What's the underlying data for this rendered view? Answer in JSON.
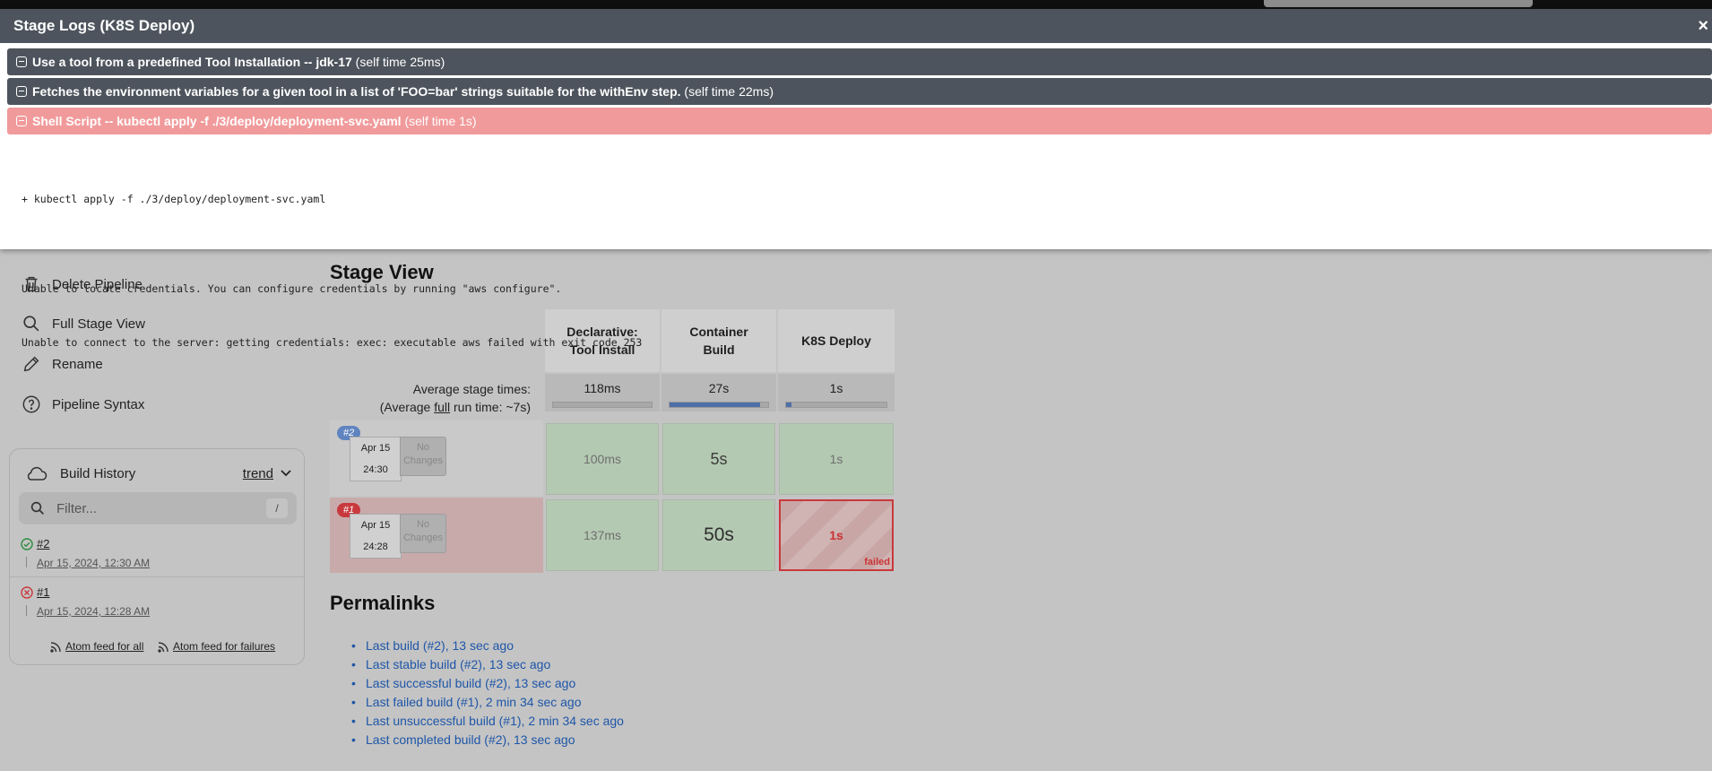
{
  "modal": {
    "title": "Stage Logs (K8S Deploy)",
    "close": "×",
    "steps": [
      {
        "title": "Use a tool from a predefined Tool Installation -- jdk-17",
        "time": "(self time 25ms)"
      },
      {
        "title": "Fetches the environment variables for a given tool in a list of 'FOO=bar' strings suitable for the withEnv step.",
        "time": "(self time 22ms)"
      },
      {
        "title": "Shell Script -- kubectl apply -f ./3/deploy/deployment-svc.yaml",
        "time": "(self time 1s)"
      }
    ],
    "log": [
      "+ kubectl apply -f ./3/deploy/deployment-svc.yaml",
      "",
      "Unable to locate credentials. You can configure credentials by running \"aws configure\".",
      "Unable to connect to the server: getting credentials: exec: executable aws failed with exit code 253"
    ]
  },
  "sidebar": {
    "items": [
      {
        "label": "Delete Pipeline",
        "icon": "trash-icon"
      },
      {
        "label": "Full Stage View",
        "icon": "search-icon"
      },
      {
        "label": "Rename",
        "icon": "pencil-icon"
      },
      {
        "label": "Pipeline Syntax",
        "icon": "help-icon"
      }
    ]
  },
  "build_history": {
    "title": "Build History",
    "trend": "trend",
    "filter_placeholder": "Filter...",
    "shortcut": "/",
    "builds": [
      {
        "number": "#2",
        "date": "Apr 15, 2024, 12:30 AM",
        "status": "success"
      },
      {
        "number": "#1",
        "date": "Apr 15, 2024, 12:28 AM",
        "status": "failed"
      }
    ],
    "atom_all": "Atom feed for all",
    "atom_failures": "Atom feed for failures"
  },
  "stage_view": {
    "title": "Stage View",
    "stages": [
      "Declarative: Tool Install",
      "Container Build",
      "K8S Deploy"
    ],
    "stage_lines": [
      [
        "Declarative:",
        "Tool Install"
      ],
      [
        "Container",
        "Build"
      ],
      [
        "K8S Deploy"
      ]
    ],
    "avg_label": "Average stage times:",
    "avg_run_prefix": "(Average ",
    "avg_run_full": "full",
    "avg_run_suffix": " run time: ~7s)",
    "avg_times": [
      "118ms",
      "27s",
      "1s"
    ],
    "avg_progress": [
      0,
      0.92,
      0.05
    ],
    "runs": [
      {
        "badge": "#2",
        "month": "Apr 15",
        "time": "24:30",
        "changes_1": "No",
        "changes_2": "Changes",
        "cells": [
          "100ms",
          "5s",
          "1s"
        ],
        "failed": false
      },
      {
        "badge": "#1",
        "month": "Apr 15",
        "time": "24:28",
        "changes_1": "No",
        "changes_2": "Changes",
        "cells": [
          "137ms",
          "50s",
          "1s"
        ],
        "failed": true,
        "failed_label": "failed"
      }
    ]
  },
  "permalinks": {
    "title": "Permalinks",
    "links": [
      "Last build (#2), 13 sec ago",
      "Last stable build (#2), 13 sec ago",
      "Last successful build (#2), 13 sec ago",
      "Last failed build (#1), 2 min 34 sec ago",
      "Last unsuccessful build (#1), 2 min 34 sec ago",
      "Last completed build (#2), 13 sec ago"
    ]
  },
  "colors": {
    "accent": "#1e56a8",
    "success": "#2e8b3e",
    "failure": "#c8393d",
    "modal_header": "#4e545d",
    "failed_step": "#f19a9b"
  }
}
